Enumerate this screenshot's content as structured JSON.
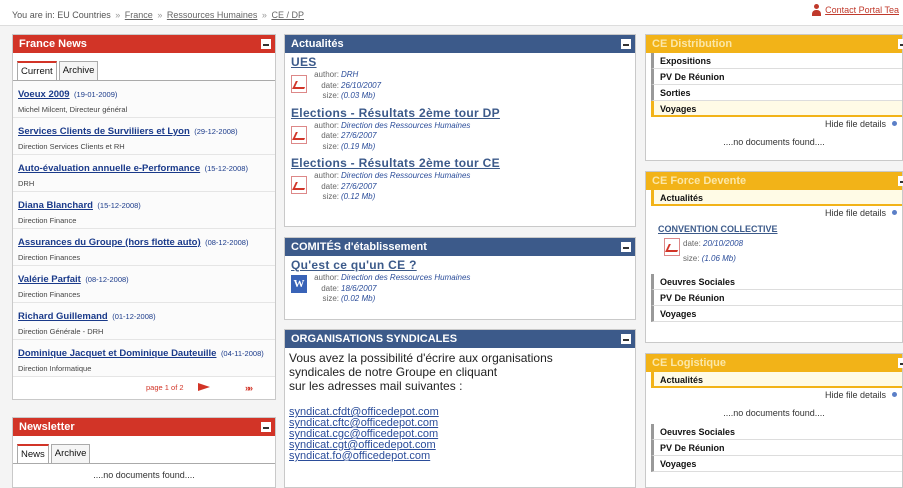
{
  "breadcrumb": {
    "prefix": "You are in:",
    "items": [
      "EU Countries",
      "France",
      "Ressources Humaines",
      "CE / DP"
    ],
    "sep": "»"
  },
  "contact": {
    "label": "Contact Portal Tea",
    "icon": "person-icon"
  },
  "france_news": {
    "title": "France News",
    "tabs": [
      "Current",
      "Archive"
    ],
    "items": [
      {
        "title": "Voeux 2009",
        "date": "(19-01-2009)",
        "sub": "Michel Milcent, Directeur général"
      },
      {
        "title": "Services Clients de Surviliiers et Lyon",
        "date": "(29-12-2008)",
        "sub": "Direction Services Clients et RH"
      },
      {
        "title": "Auto-évaluation annuelle e-Performance",
        "date": "(15-12-2008)",
        "sub": "DRH"
      },
      {
        "title": "Diana Blanchard",
        "date": "(15-12-2008)",
        "sub": "Direction Finance"
      },
      {
        "title": "Assurances du Groupe (hors flotte auto)",
        "date": "(08-12-2008)",
        "sub": "Direction Finances"
      },
      {
        "title": "Valérie Parfait",
        "date": "(08-12-2008)",
        "sub": "Direction Finances"
      },
      {
        "title": "Richard Guillemand",
        "date": "(01-12-2008)",
        "sub": "Direction Générale - DRH"
      },
      {
        "title": "Dominique Jacquet et Dominique Dauteuille",
        "date": "(04-11-2008)",
        "sub": "Direction Informatique"
      }
    ],
    "pager": "page 1 of 2",
    "last": "»»"
  },
  "newsletter": {
    "title": "Newsletter",
    "tabs": [
      "News",
      "Archive"
    ],
    "empty": "....no documents found...."
  },
  "actualites": {
    "title": "Actualités",
    "labels": {
      "author": "author:",
      "date": "date:",
      "size": "size:"
    },
    "docs": [
      {
        "title": "UES",
        "author": "DRH",
        "date": "26/10/2007",
        "size": "(0.03 Mb)"
      },
      {
        "title": "Elections - Résultats 2ème tour DP",
        "author": "Direction des Ressources Humaines",
        "date": "27/6/2007",
        "size": "(0.19 Mb)"
      },
      {
        "title": "Elections - Résultats 2ème tour CE",
        "author": "Direction des Ressources Humaines",
        "date": "27/6/2007",
        "size": "(0.12 Mb)"
      }
    ]
  },
  "comites": {
    "title": "COMITÉS d'établissement",
    "doc": {
      "title": "Qu'est ce qu'un CE ?",
      "author": "Direction des Ressources Humaines",
      "date": "18/6/2007",
      "size": "(0.02 Mb)",
      "icon_letter": "W"
    }
  },
  "syndicales": {
    "title": "ORGANISATIONS SYNDICALES",
    "text": [
      "Vous avez la possibilité d'écrire aux organisations",
      "syndicales de notre Groupe en cliquant",
      "sur les adresses mail suivantes :"
    ],
    "emails": [
      "syndicat.cfdt@officedepot.com",
      "syndicat.cftc@officedepot.com",
      "syndicat.cgc@officedepot.com",
      "syndicat.cgt@officedepot.com",
      "syndicat.fo@officedepot.com"
    ]
  },
  "ce_distribution": {
    "title": "CE Distribution",
    "items": [
      "Expositions",
      "PV De Réunion",
      "Sorties",
      "Voyages"
    ],
    "hide": "Hide file details",
    "empty": "....no documents found...."
  },
  "ce_force": {
    "title": "CE Force Devente",
    "selected": "Actualités",
    "hide": "Hide file details",
    "doc": {
      "title": "CONVENTION COLLECTIVE",
      "date_label": "date:",
      "date": "20/10/2008",
      "size_label": "size:",
      "size": "(1.06 Mb)"
    },
    "items": [
      "Oeuvres Sociales",
      "PV De Réunion",
      "Voyages"
    ]
  },
  "ce_logistique": {
    "title": "CE Logistique",
    "selected": "Actualités",
    "hide": "Hide file details",
    "empty": "....no documents found....",
    "items": [
      "Oeuvres Sociales",
      "PV De Réunion",
      "Voyages"
    ]
  }
}
